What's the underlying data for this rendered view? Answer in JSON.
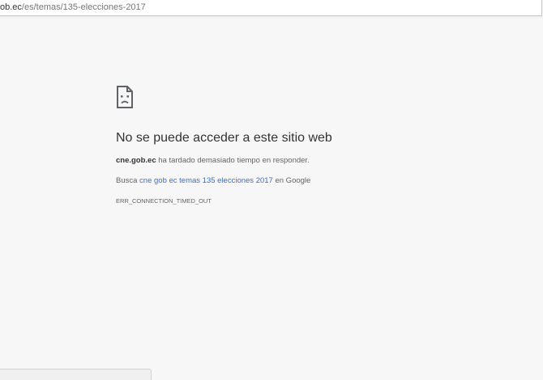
{
  "address_bar": {
    "host_fragment": "ob.ec",
    "path": "/es/temas/135-elecciones-2017"
  },
  "error_page": {
    "icon": "sad-page-icon",
    "title": "No se puede acceder a este sitio web",
    "host": "cne.gob.ec",
    "host_message": " ha tardado demasiado tiempo en responder.",
    "search_prefix": "Busca ",
    "search_query": "cne gob ec temas 135 elecciones 2017",
    "search_suffix": " en Google",
    "error_code": "ERR_CONNECTION_TIMED_OUT"
  },
  "colors": {
    "page_background": "#f7f7f7",
    "link": "#3a6fc4",
    "text": "#333333",
    "secondary_text": "#646464"
  }
}
